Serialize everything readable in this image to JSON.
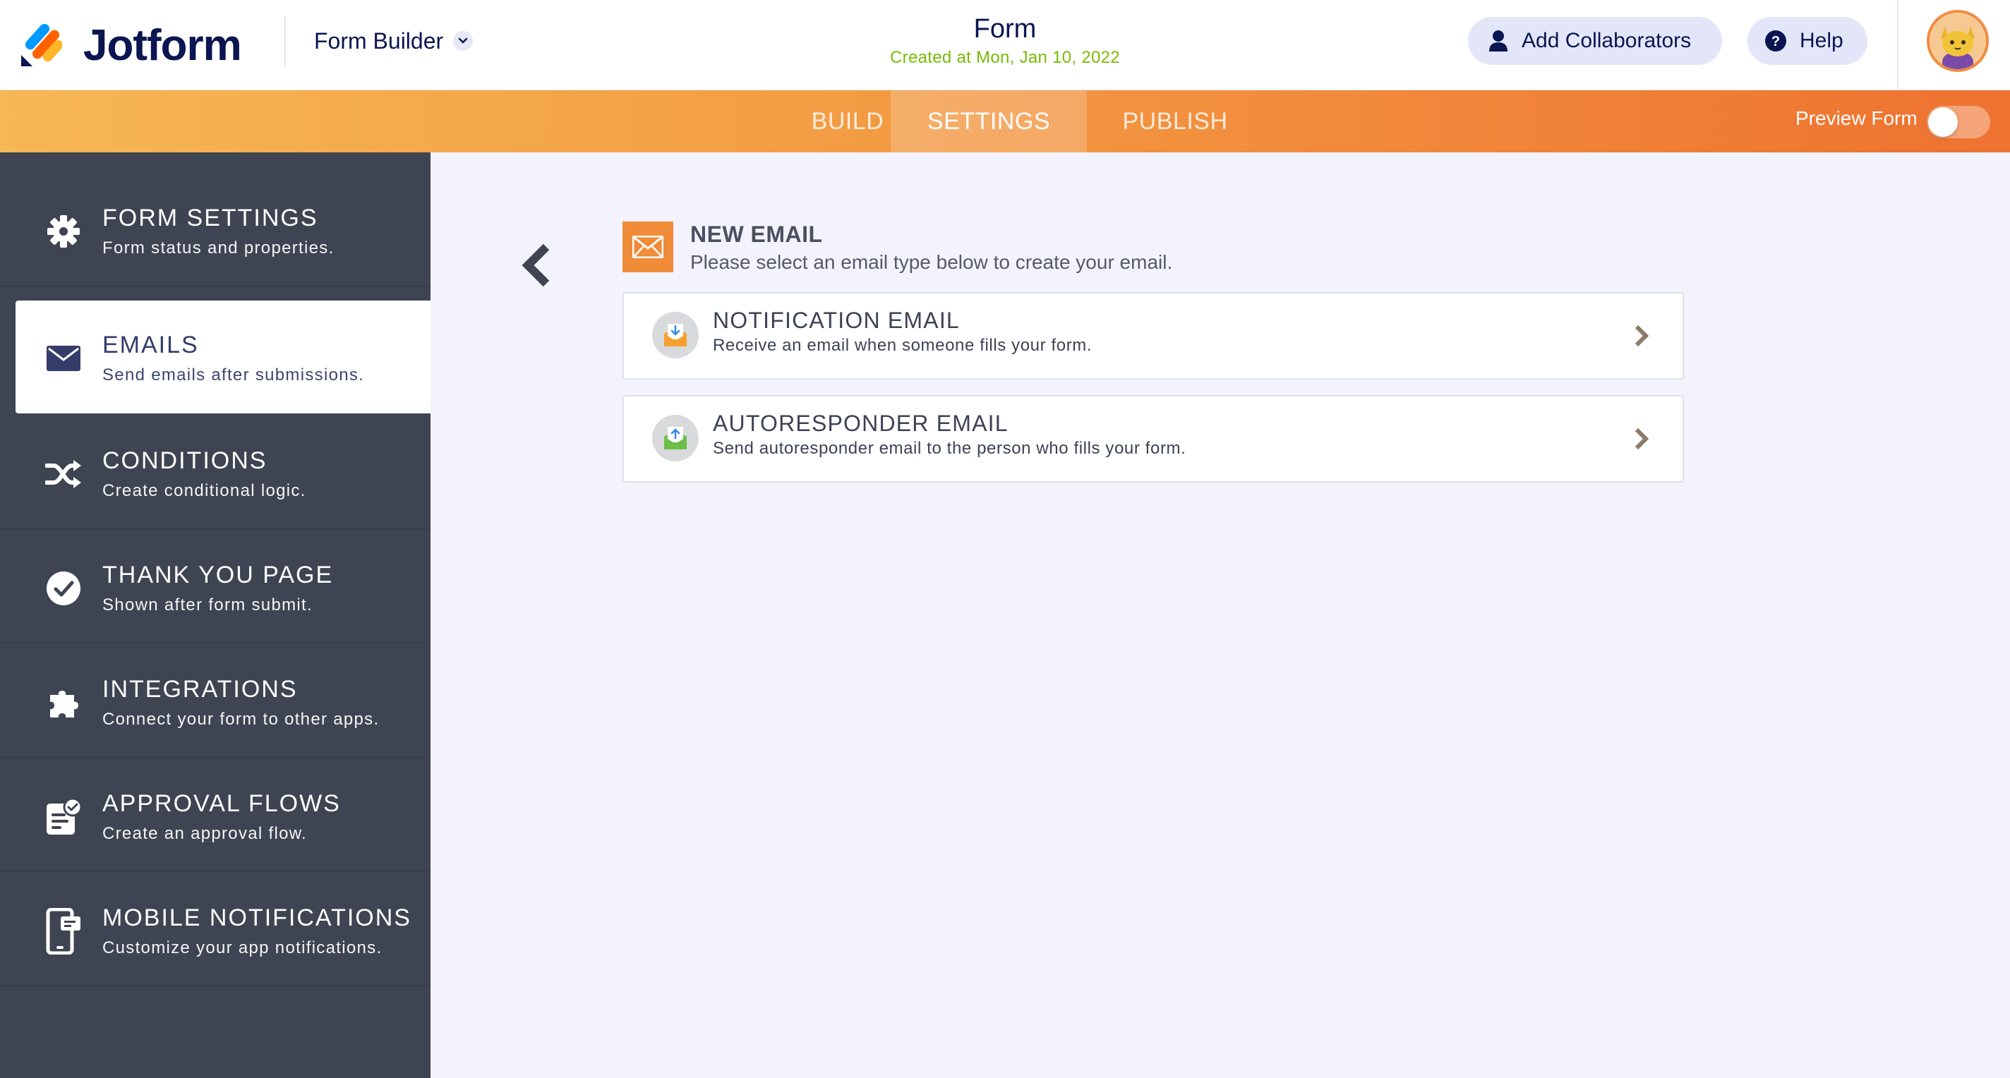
{
  "header": {
    "brand": "Jotform",
    "builder_label": "Form Builder",
    "form_title": "Form",
    "form_created": "Created at Mon, Jan 10, 2022",
    "collab_label": "Add Collaborators",
    "help_label": "Help"
  },
  "nav": {
    "tabs": [
      {
        "label": "BUILD"
      },
      {
        "label": "SETTINGS"
      },
      {
        "label": "PUBLISH"
      }
    ],
    "active_tab": "SETTINGS",
    "preview_label": "Preview Form",
    "preview_on": false
  },
  "sidebar": {
    "items": [
      {
        "title": "FORM SETTINGS",
        "desc": "Form status and properties.",
        "icon": "gear-icon"
      },
      {
        "title": "EMAILS",
        "desc": "Send emails after submissions.",
        "icon": "envelope-icon"
      },
      {
        "title": "CONDITIONS",
        "desc": "Create conditional logic.",
        "icon": "shuffle-icon"
      },
      {
        "title": "THANK YOU PAGE",
        "desc": "Shown after form submit.",
        "icon": "check-circle-icon"
      },
      {
        "title": "INTEGRATIONS",
        "desc": "Connect your form to other apps.",
        "icon": "puzzle-icon"
      },
      {
        "title": "APPROVAL FLOWS",
        "desc": "Create an approval flow.",
        "icon": "approval-icon"
      },
      {
        "title": "MOBILE NOTIFICATIONS",
        "desc": "Customize your app notifications.",
        "icon": "mobile-icon"
      }
    ],
    "active_item": "EMAILS"
  },
  "main": {
    "new_email_title": "NEW EMAIL",
    "new_email_desc": "Please select an email type below to create your email.",
    "cards": [
      {
        "title": "NOTIFICATION EMAIL",
        "desc": "Receive an email when someone fills your form.",
        "icon": "notification-email-icon",
        "color": "#f5a030"
      },
      {
        "title": "AUTORESPONDER EMAIL",
        "desc": "Send autoresponder email to the person who fills your form.",
        "icon": "autoresponder-email-icon",
        "color": "#6cbf4b"
      }
    ]
  },
  "colors": {
    "brand_dark": "#0a1551",
    "created_green": "#78bb07",
    "sidebar_bg": "#3f4452",
    "accent_orange": "#f08b3a"
  }
}
